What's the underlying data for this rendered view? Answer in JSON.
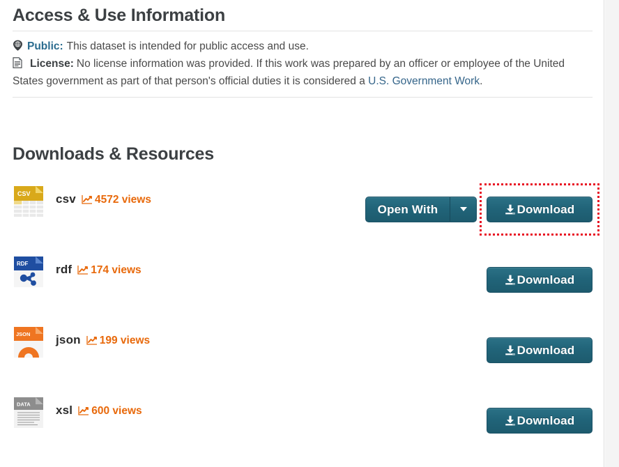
{
  "access_section": {
    "heading": "Access & Use Information",
    "public": {
      "icon": "globe-icon",
      "label": "Public:",
      "text": "This dataset is intended for public access and use."
    },
    "license": {
      "icon": "document-icon",
      "label": "License:",
      "text_before_link": "No license information was provided. If this work was prepared by an officer or employee of the United States government as part of that person's official duties it is considered a ",
      "link_text": "U.S. Government Work",
      "text_after_link": "."
    }
  },
  "downloads_section": {
    "heading": "Downloads & Resources",
    "open_with": {
      "label": "Open With",
      "caret_icon": "chevron-down-icon"
    },
    "download_label": "Download",
    "download_icon": "download-icon",
    "views_icon": "line-chart-icon",
    "views_suffix": "views",
    "resources": [
      {
        "format": "csv",
        "views": "4572",
        "views_text": "4572 views",
        "icon": "csv-file-icon",
        "icon_label": "CSV",
        "icon_color": "#d9a91a",
        "has_open_with": true,
        "download_label": "Download"
      },
      {
        "format": "rdf",
        "views": "174",
        "views_text": "174 views",
        "icon": "rdf-file-icon",
        "icon_label": "RDF",
        "icon_color": "#1f4ea1",
        "has_open_with": false,
        "download_label": "Download"
      },
      {
        "format": "json",
        "views": "199",
        "views_text": "199 views",
        "icon": "json-file-icon",
        "icon_label": "JSON",
        "icon_color": "#ef7521",
        "has_open_with": false,
        "download_label": "Download"
      },
      {
        "format": "xsl",
        "views": "600",
        "views_text": "600 views",
        "icon": "data-file-icon",
        "icon_label": "DATA",
        "icon_color": "#8d8d8d",
        "has_open_with": false,
        "download_label": "Download"
      }
    ]
  },
  "annotation": {
    "highlight_target": "download-button-csv",
    "highlight_color": "#e81123"
  },
  "colors": {
    "button_teal": "#216479",
    "accent_orange": "#e8690b",
    "link_blue": "#35658a",
    "public_label_blue": "#2b6c8f",
    "heading_gray": "#3c4043"
  }
}
